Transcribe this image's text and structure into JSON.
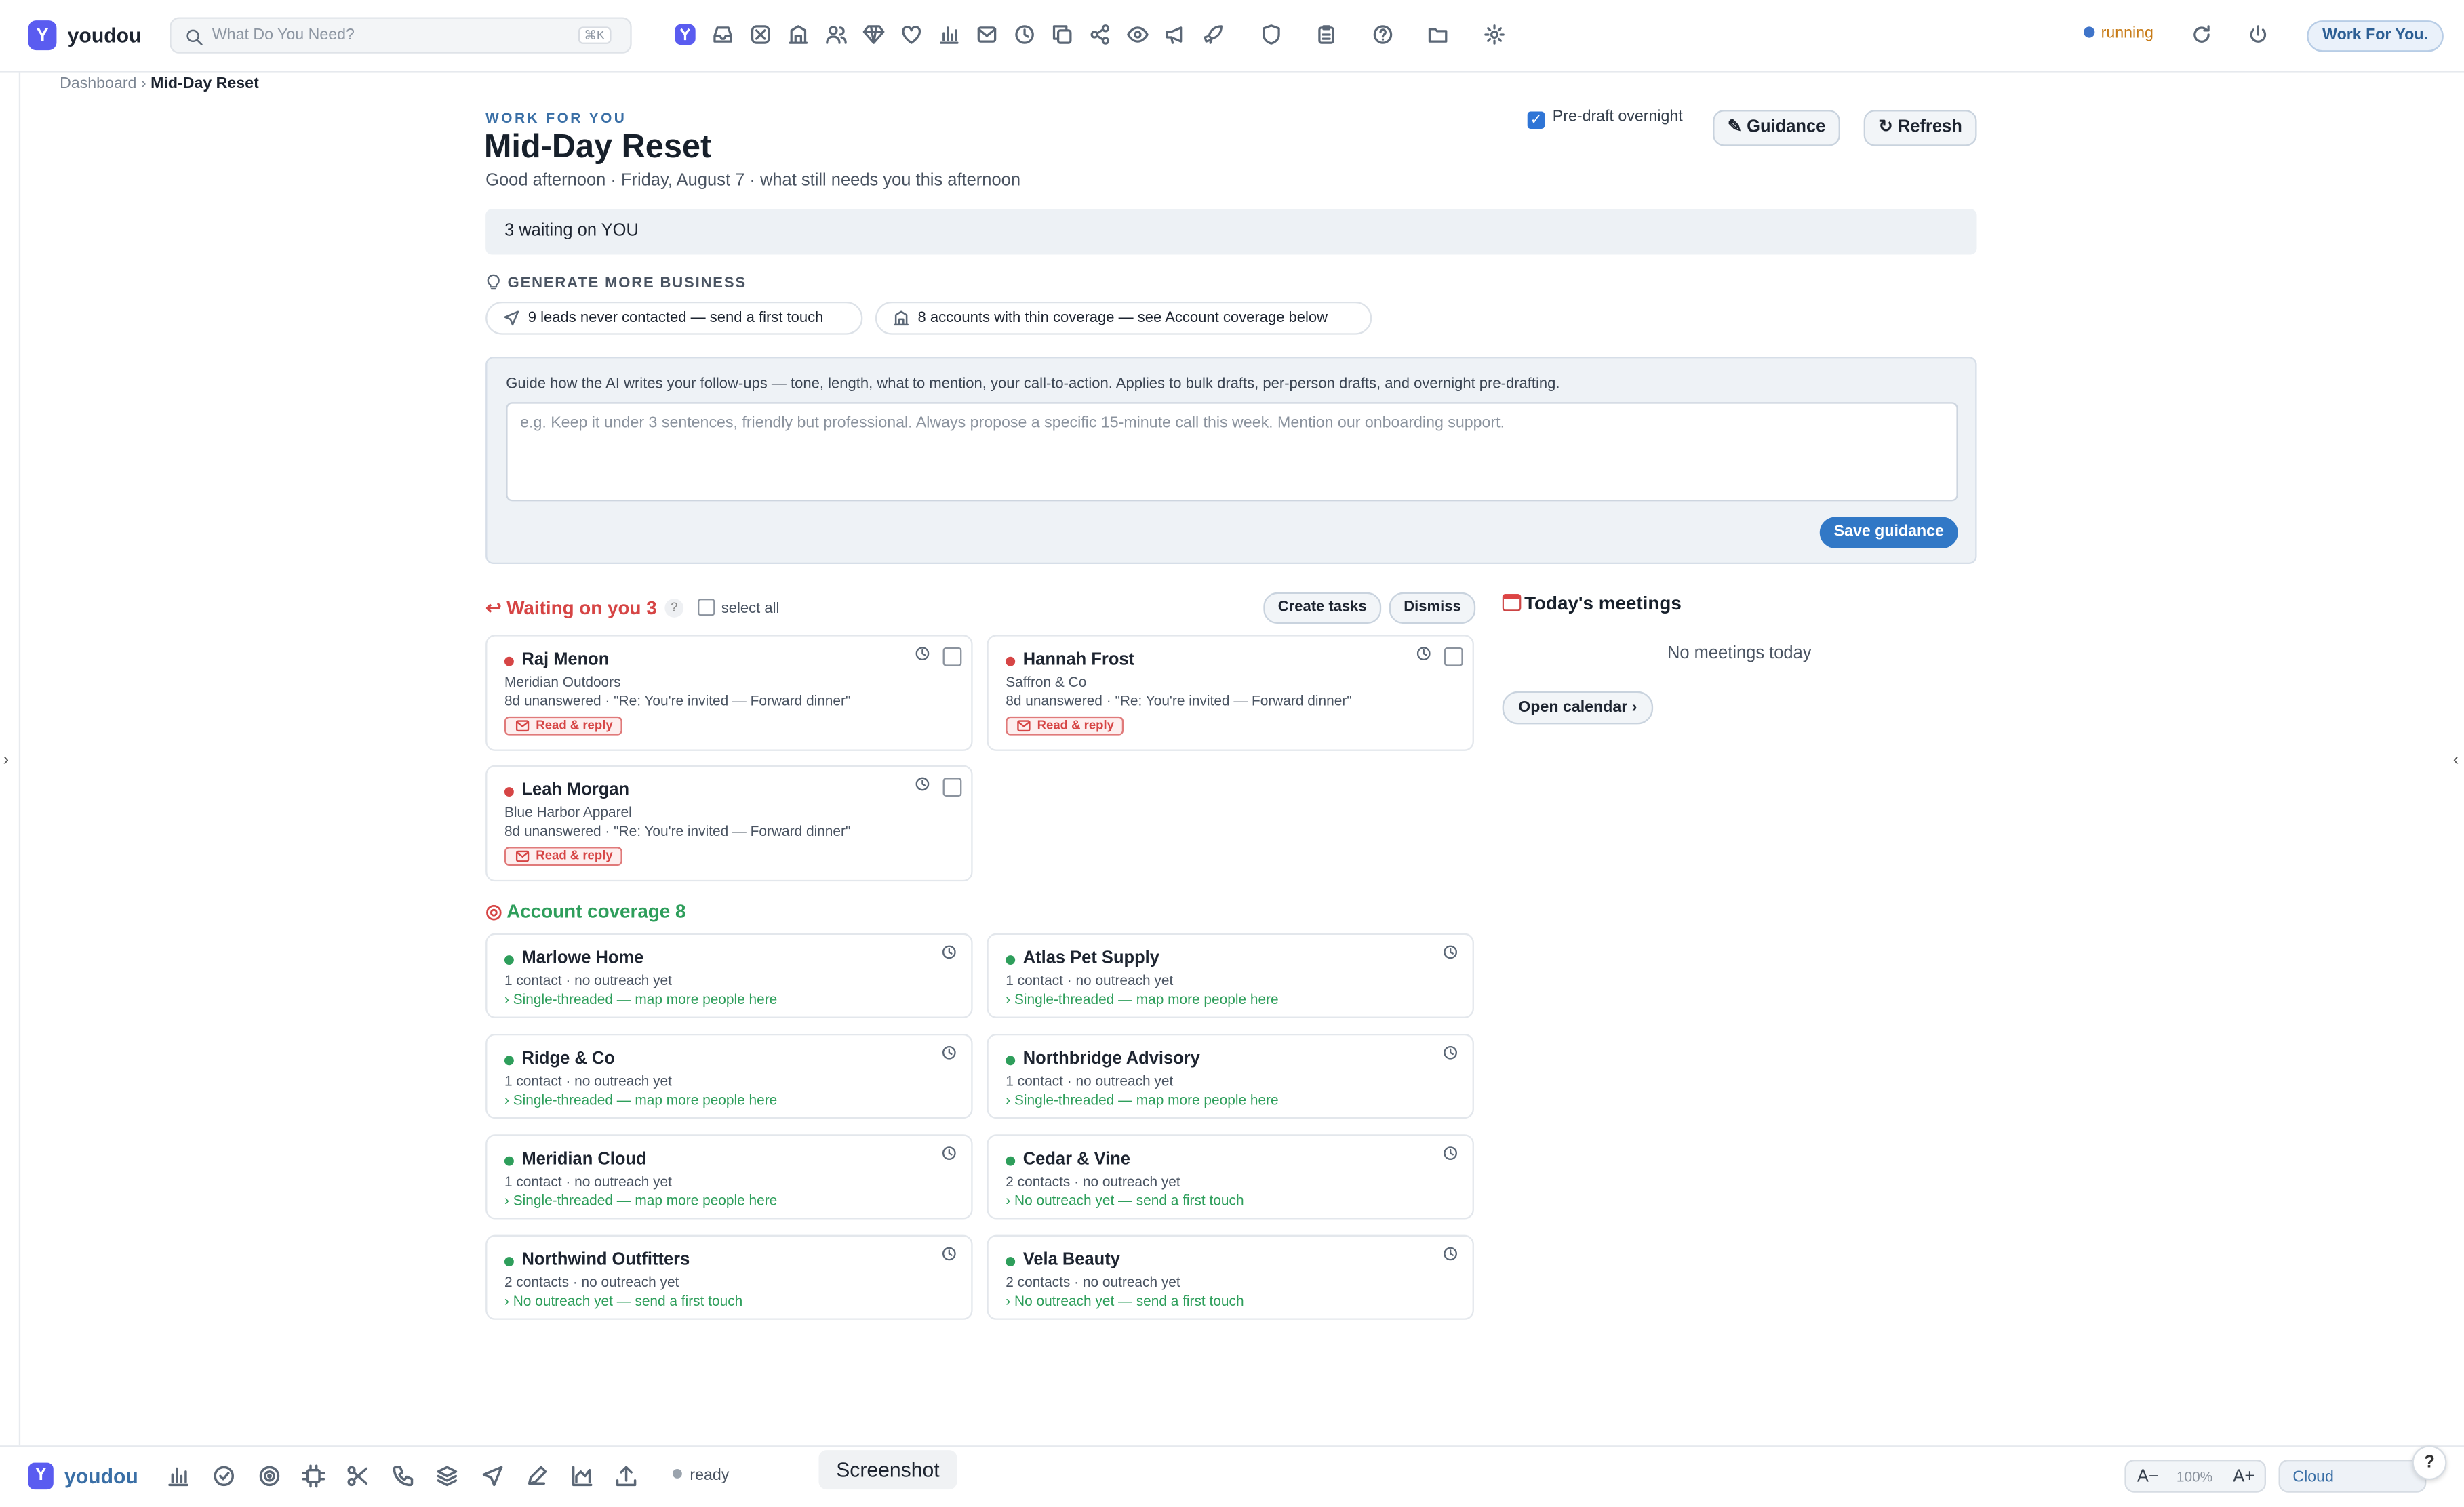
{
  "app": {
    "brand": "youdou",
    "logo_letter": "Y"
  },
  "search": {
    "placeholder": "What Do You Need?",
    "shortcut": "⌘K"
  },
  "toolbar_icons": [
    "app-logo-icon",
    "inbox-icon",
    "target-icon",
    "building-icon",
    "people-icon",
    "diamond-icon",
    "heart-icon",
    "bar-chart-icon",
    "mail-icon",
    "clock-icon",
    "copy-icon",
    "share-icon",
    "eye-icon",
    "megaphone-icon",
    "rocket-icon",
    "shield-icon",
    "clipboard-icon",
    "help-circle-icon",
    "folder-icon",
    "gear-icon"
  ],
  "status": {
    "label": "running",
    "color": "#c77b17"
  },
  "work_for_you_button": "Work For You.",
  "breadcrumb": {
    "parent": "Dashboard",
    "separator": "›",
    "current": "Mid-Day Reset"
  },
  "header": {
    "eyebrow": "WORK FOR YOU",
    "title": "Mid-Day Reset",
    "subtitle": "Good afternoon · Friday, August 7 · what still needs you this afternoon",
    "predraft_label": "Pre-draft overnight",
    "predraft_checked": true,
    "guidance_button": "✎ Guidance",
    "refresh_button": "↻ Refresh"
  },
  "waiting_banner": "3 waiting on YOU",
  "generate": {
    "heading": "GENERATE MORE BUSINESS",
    "chips": [
      {
        "label": "9 leads never contacted — send a first touch",
        "icon": "send-icon"
      },
      {
        "label": "8 accounts with thin coverage — see Account coverage below",
        "icon": "building-icon"
      }
    ]
  },
  "guidance": {
    "intro": "Guide how the AI writes your follow-ups — tone, length, what to mention, your call-to-action. Applies to bulk drafts, per-person drafts, and overnight pre-drafting.",
    "placeholder": "e.g. Keep it under 3 sentences, friendly but professional. Always propose a specific 15-minute call this week. Mention our onboarding support.",
    "save_button": "Save guidance"
  },
  "waiting": {
    "heading": "Waiting on you",
    "count": "3",
    "help": "?",
    "select_all": "select all",
    "create_tasks": "Create tasks",
    "dismiss": "Dismiss",
    "action_label": "Read & reply",
    "items": [
      {
        "name": "Raj Menon",
        "company": "Meridian Outdoors",
        "detail": "8d unanswered · \"Re: You're invited — Forward dinner\""
      },
      {
        "name": "Hannah Frost",
        "company": "Saffron & Co",
        "detail": "8d unanswered · \"Re: You're invited — Forward dinner\""
      },
      {
        "name": "Leah Morgan",
        "company": "Blue Harbor Apparel",
        "detail": "8d unanswered · \"Re: You're invited — Forward dinner\""
      }
    ]
  },
  "meetings": {
    "heading": "Today's meetings",
    "empty": "No meetings today",
    "open_calendar": "Open calendar ›"
  },
  "coverage": {
    "heading": "Account coverage",
    "count": "8",
    "items": [
      {
        "name": "Marlowe Home",
        "contacts": "1 contact · no outreach yet",
        "hint": "› Single-threaded — map more people here"
      },
      {
        "name": "Atlas Pet Supply",
        "contacts": "1 contact · no outreach yet",
        "hint": "› Single-threaded — map more people here"
      },
      {
        "name": "Ridge & Co",
        "contacts": "1 contact · no outreach yet",
        "hint": "› Single-threaded — map more people here"
      },
      {
        "name": "Northbridge Advisory",
        "contacts": "1 contact · no outreach yet",
        "hint": "› Single-threaded — map more people here"
      },
      {
        "name": "Meridian Cloud",
        "contacts": "1 contact · no outreach yet",
        "hint": "› Single-threaded — map more people here"
      },
      {
        "name": "Cedar & Vine",
        "contacts": "2 contacts · no outreach yet",
        "hint": "› No outreach yet — send a first touch"
      },
      {
        "name": "Northwind Outfitters",
        "contacts": "2 contacts · no outreach yet",
        "hint": "› No outreach yet — send a first touch"
      },
      {
        "name": "Vela Beauty",
        "contacts": "2 contacts · no outreach yet",
        "hint": "› No outreach yet — send a first touch"
      }
    ]
  },
  "bottom": {
    "brand": "youdou",
    "icons": [
      "bar-chart-icon",
      "check-circle-icon",
      "target-icon",
      "chip-icon",
      "scissors-icon",
      "phone-icon",
      "layers-icon",
      "send-icon",
      "pen-icon",
      "area-chart-icon",
      "upload-icon"
    ],
    "ready": "ready",
    "screenshot": "Screenshot",
    "zoom_out": "A−",
    "zoom": "100%",
    "zoom_in": "A+",
    "cloud": "Cloud",
    "help": "?"
  },
  "colors": {
    "accent": "#3178c6",
    "waiting": "#d64545",
    "coverage": "#2e9e5b",
    "brand": "#5a5cf0"
  }
}
